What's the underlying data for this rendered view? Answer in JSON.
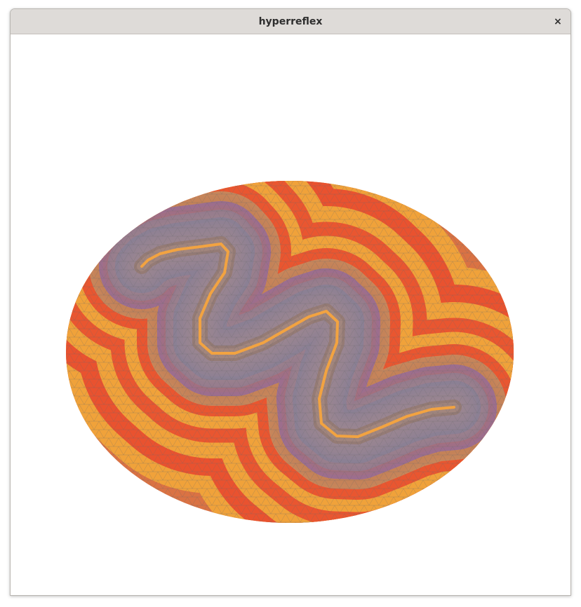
{
  "window": {
    "title": "hyperreflex",
    "close_glyph": "×"
  },
  "visualization": {
    "shape": "ellipse",
    "description_colors": {
      "far": "#c94b4b",
      "warm_orange": "#f0a23a",
      "red_band": "#e8492f",
      "purple_mid": "#8a68b8",
      "blue_core": "#3b7cf0",
      "skeleton": "#f2a341",
      "dark_boundary": "#1f2a2a",
      "mesh_line": "#6b6b6b"
    }
  }
}
